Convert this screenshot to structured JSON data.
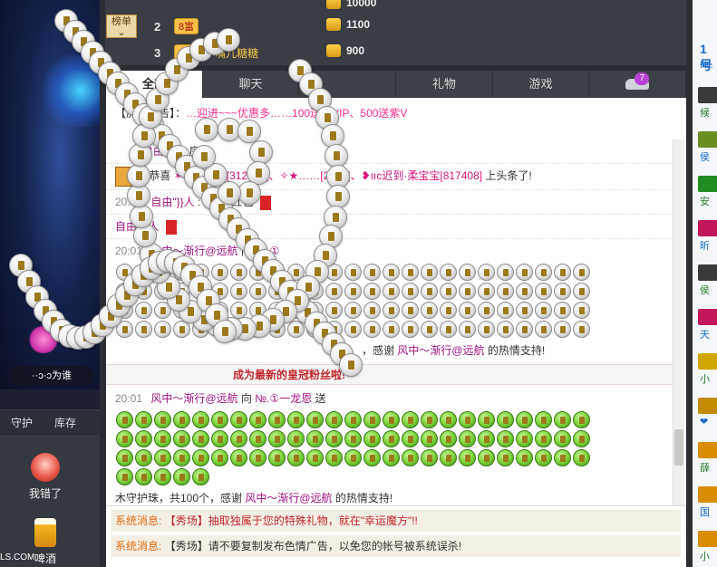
{
  "leaderboard": {
    "badge_label": "榜单",
    "rows": [
      {
        "rank": "2",
        "tag": "8富",
        "name": "",
        "score": "1100"
      },
      {
        "rank": "3",
        "tag": "6富",
        "name": "小嘴儿糖糖",
        "score": "900"
      }
    ],
    "top_score_partial": "10000"
  },
  "tabs": [
    {
      "label": "全部",
      "active": true
    },
    {
      "label": "聊天",
      "active": false
    },
    {
      "label": "",
      "active": false
    },
    {
      "label": "礼物",
      "active": false
    },
    {
      "label": "游戏",
      "active": false
    },
    {
      "label": "",
      "active": false,
      "badge": "7"
    }
  ],
  "notice": {
    "prefix": "【房间公告】：",
    "body": "…迎进~~~优惠多……100送黄VIP、500送紫V"
  },
  "chat": {
    "msg1_user": "自由\"}}人",
    "msg1_text": "房间",
    "msg2_prefix": "恭喜",
    "msg2_names": "✶住在未来[312999]、✧★……[2258]、❥ııc迟到·柔宝宝[817408]",
    "msg2_suffix": "上头条了!",
    "msg3_time": "20:00",
    "msg3_user": "自由\"}}人",
    "msg3_text": ": 送1个红包",
    "msg4_user": "自由\"}}人",
    "msg5_time": "20:01",
    "msg5_user": "风中～渐行@远航",
    "msg5_to": "向",
    "msg5_target": "№.①",
    "msg5_tail": "，感谢",
    "msg5_thanks_user": "风中～渐行@远航",
    "msg5_end": "的热情支持!",
    "crown_banner": "成为最新的皇冠粉丝啦!",
    "msg6_time": "20:01",
    "msg6_user": "风中～渐行@远航",
    "msg6_to": "向",
    "msg6_target": "№.①一龙恩",
    "msg6_send": "送",
    "msg6_tail": "木守护珠，共100个，感谢",
    "msg6_thanks_user": "风中～渐行@远航",
    "msg6_end": "的热情支持!"
  },
  "system": [
    {
      "label": "系统消息:",
      "text": "【秀场】抽取独属于您的特殊礼物，就在\"幸运魔方\"!!"
    },
    {
      "label": "系统消息:",
      "text": "【秀场】请不要复制发布色情广告，以免您的帐号被系统误杀!"
    }
  ],
  "left": {
    "host_name": "··ɔ·ɔ为谁",
    "tab_guard": "守护",
    "tab_store": "库存",
    "gift1": "我错了",
    "gift2": "啤酒",
    "footer": "LS.COM"
  },
  "right": {
    "title": "1号",
    "sub": "№.",
    "items": [
      "候",
      "侯",
      "安",
      "昕",
      "侯",
      "天",
      "小",
      "❤",
      "薛",
      "国",
      "小"
    ]
  },
  "colors": {
    "accent_pink": "#d6157b",
    "username_purple": "#a0117f",
    "system_orange": "#e36b10",
    "system_red": "#c2272d"
  }
}
